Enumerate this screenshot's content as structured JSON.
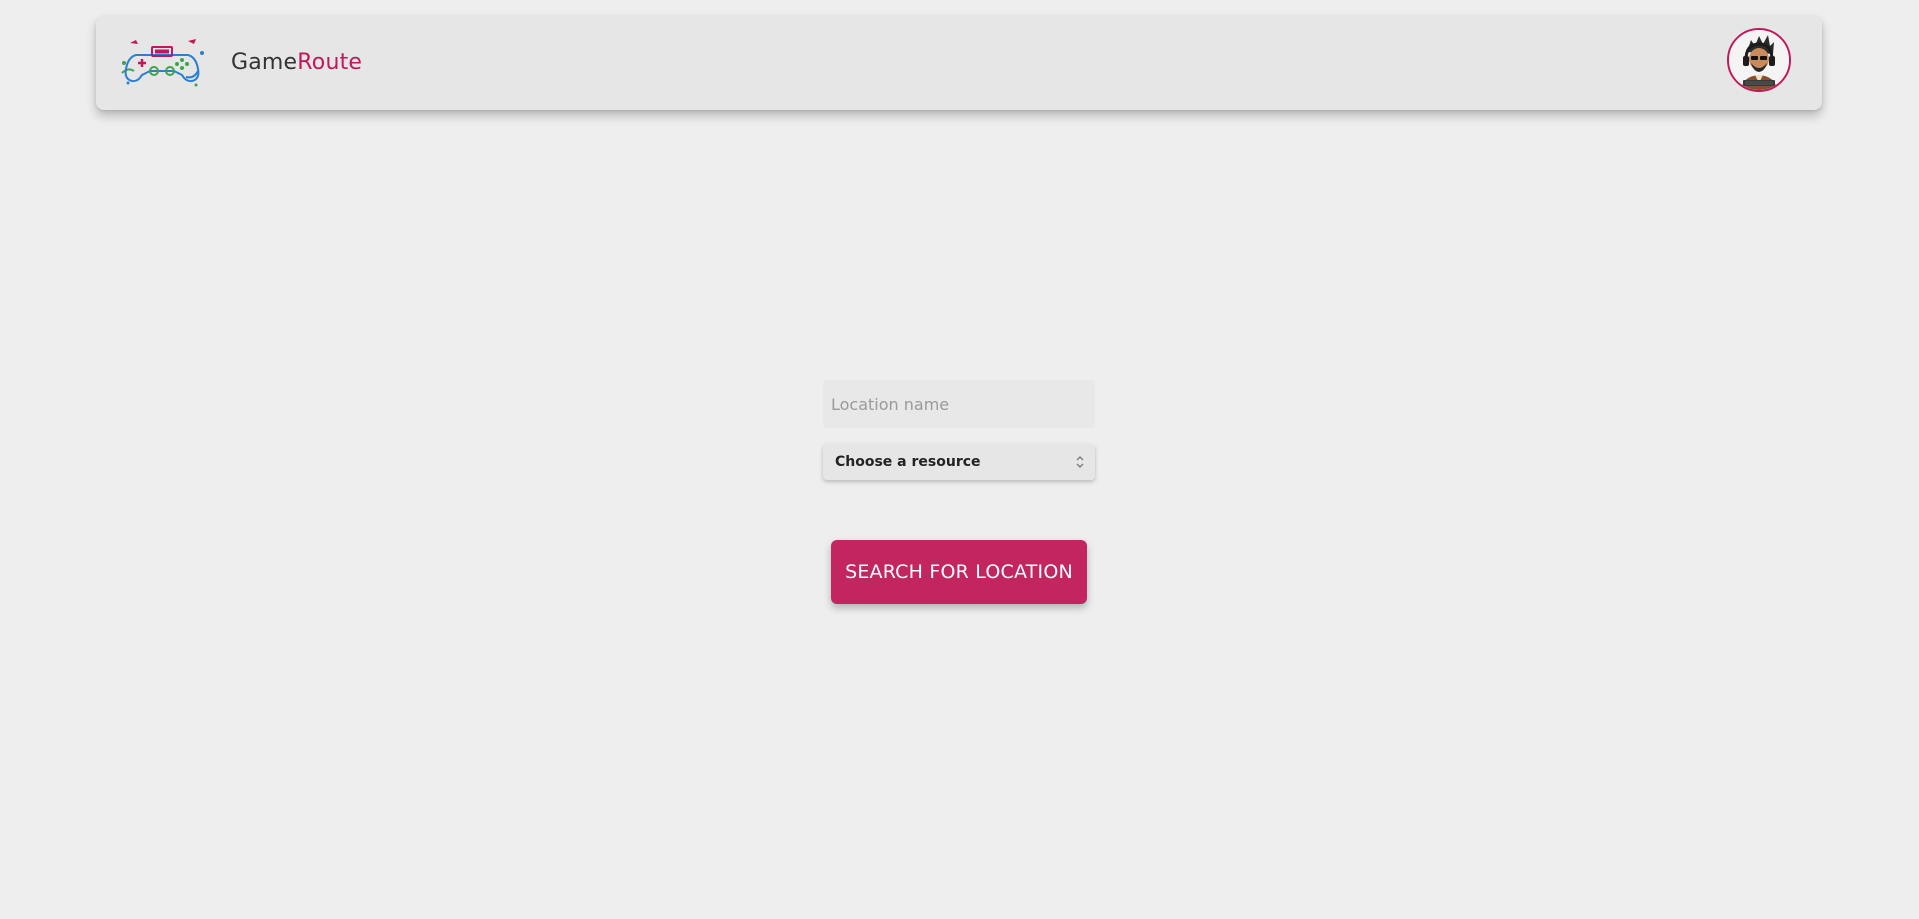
{
  "header": {
    "logo_icon": "gamepad-logo-icon",
    "brand_part1": "Game",
    "brand_part2": "Route",
    "avatar_icon": "gamer-avatar-icon"
  },
  "form": {
    "location_input": {
      "placeholder": "Location name",
      "value": ""
    },
    "resource_select": {
      "selected": "Choose a resource",
      "icon": "updown-chevron-icon"
    },
    "search_button_label": "SEARCH FOR LOCATION"
  },
  "colors": {
    "accent": "#c2185b",
    "button": "#c2255f",
    "background": "#eeeeee",
    "navbar": "#e6e6e6"
  }
}
